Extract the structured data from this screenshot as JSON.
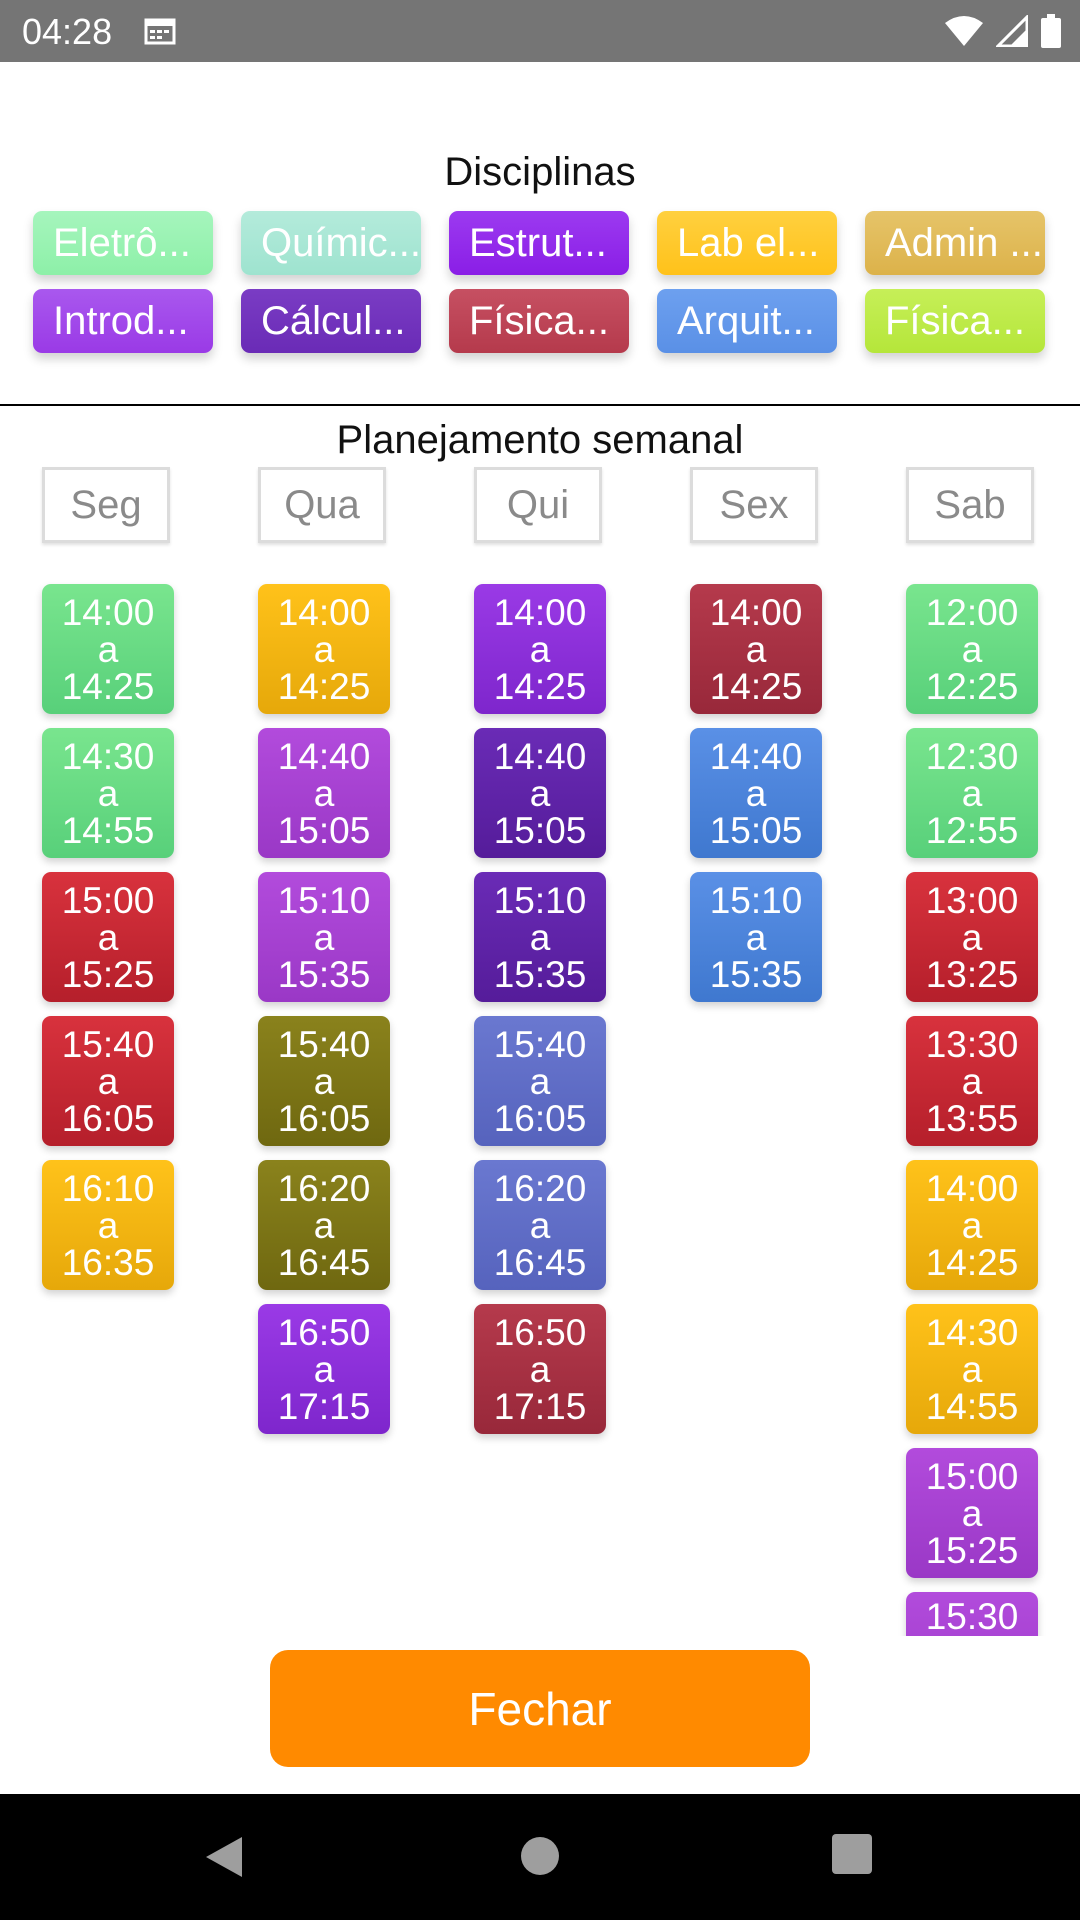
{
  "status_bar": {
    "time": "04:28"
  },
  "disciplinas": {
    "title": "Disciplinas",
    "chips": [
      {
        "label": "Eletrô...",
        "color": "#8df0a8",
        "color2": "#a6f5bd"
      },
      {
        "label": "Químic...",
        "color": "#9ee3cf",
        "color2": "#b4ebdb"
      },
      {
        "label": "Estrut...",
        "color": "#8a1ee6",
        "color2": "#9c3af0"
      },
      {
        "label": "Lab el...",
        "color": "#ffc21a",
        "color2": "#ffd03f"
      },
      {
        "label": "Admin ...",
        "color": "#dcb24a",
        "color2": "#e6c469"
      },
      {
        "label": "Introd...",
        "color": "#9a3ae6",
        "color2": "#a958ee"
      },
      {
        "label": "Cálcul...",
        "color": "#6a2bb6",
        "color2": "#7a3cc4"
      },
      {
        "label": "Física...",
        "color": "#b53a4c",
        "color2": "#c65062"
      },
      {
        "label": "Arquit...",
        "color": "#5a90e6",
        "color2": "#6da0ef"
      },
      {
        "label": "Física...",
        "color": "#b5e63a",
        "color2": "#c6ef58"
      }
    ]
  },
  "planejamento": {
    "title": "Planejamento semanal"
  },
  "days": [
    "Seg",
    "Qua",
    "Qui",
    "Sex",
    "Sab"
  ],
  "schedule": [
    [
      {
        "start": "14:00",
        "sep": "a",
        "end": "14:25",
        "color": "#79e58e",
        "color2": "#58d07a"
      },
      {
        "start": "14:30",
        "sep": "a",
        "end": "14:55",
        "color": "#79e58e",
        "color2": "#58d07a"
      },
      {
        "start": "15:00",
        "sep": "a",
        "end": "15:25",
        "color": "#d8323d",
        "color2": "#b51f2b"
      },
      {
        "start": "15:40",
        "sep": "a",
        "end": "16:05",
        "color": "#d8323d",
        "color2": "#b51f2b"
      },
      {
        "start": "16:10",
        "sep": "a",
        "end": "16:35",
        "color": "#ffc21a",
        "color2": "#e6a80a"
      }
    ],
    [
      {
        "start": "14:00",
        "sep": "a",
        "end": "14:25",
        "color": "#ffc21a",
        "color2": "#e6a80a"
      },
      {
        "start": "14:40",
        "sep": "a",
        "end": "15:05",
        "color": "#b24bdc",
        "color2": "#9a38c6"
      },
      {
        "start": "15:10",
        "sep": "a",
        "end": "15:35",
        "color": "#b24bdc",
        "color2": "#9a38c6"
      },
      {
        "start": "15:40",
        "sep": "a",
        "end": "16:05",
        "color": "#8a821c",
        "color2": "#6f6810"
      },
      {
        "start": "16:20",
        "sep": "a",
        "end": "16:45",
        "color": "#8a821c",
        "color2": "#6f6810"
      },
      {
        "start": "16:50",
        "sep": "a",
        "end": "17:15",
        "color": "#9a3ae6",
        "color2": "#7e26cc"
      }
    ],
    [
      {
        "start": "14:00",
        "sep": "a",
        "end": "14:25",
        "color": "#9a3ae6",
        "color2": "#7e26cc"
      },
      {
        "start": "14:40",
        "sep": "a",
        "end": "15:05",
        "color": "#6a2bb6",
        "color2": "#551c9a"
      },
      {
        "start": "15:10",
        "sep": "a",
        "end": "15:35",
        "color": "#6a2bb6",
        "color2": "#551c9a"
      },
      {
        "start": "15:40",
        "sep": "a",
        "end": "16:05",
        "color": "#6a78d0",
        "color2": "#5663bd"
      },
      {
        "start": "16:20",
        "sep": "a",
        "end": "16:45",
        "color": "#6a78d0",
        "color2": "#5663bd"
      },
      {
        "start": "16:50",
        "sep": "a",
        "end": "17:15",
        "color": "#b53a4c",
        "color2": "#98283a"
      }
    ],
    [
      {
        "start": "14:00",
        "sep": "a",
        "end": "14:25",
        "color": "#b53a4c",
        "color2": "#98283a"
      },
      {
        "start": "14:40",
        "sep": "a",
        "end": "15:05",
        "color": "#5a90e6",
        "color2": "#3f78cf"
      },
      {
        "start": "15:10",
        "sep": "a",
        "end": "15:35",
        "color": "#5a90e6",
        "color2": "#3f78cf"
      }
    ],
    [
      {
        "start": "12:00",
        "sep": "a",
        "end": "12:25",
        "color": "#79e58e",
        "color2": "#58d07a"
      },
      {
        "start": "12:30",
        "sep": "a",
        "end": "12:55",
        "color": "#79e58e",
        "color2": "#58d07a"
      },
      {
        "start": "13:00",
        "sep": "a",
        "end": "13:25",
        "color": "#d8323d",
        "color2": "#b51f2b"
      },
      {
        "start": "13:30",
        "sep": "a",
        "end": "13:55",
        "color": "#d8323d",
        "color2": "#b51f2b"
      },
      {
        "start": "14:00",
        "sep": "a",
        "end": "14:25",
        "color": "#ffc21a",
        "color2": "#e6a80a"
      },
      {
        "start": "14:30",
        "sep": "a",
        "end": "14:55",
        "color": "#ffc21a",
        "color2": "#e6a80a"
      },
      {
        "start": "15:00",
        "sep": "a",
        "end": "15:25",
        "color": "#b24bdc",
        "color2": "#9a38c6"
      },
      {
        "start": "15:30",
        "sep": "",
        "end": "",
        "color": "#b24bdc",
        "color2": "#9a38c6"
      }
    ]
  ],
  "button": {
    "label": "Fechar",
    "color": "#ff8a00"
  }
}
